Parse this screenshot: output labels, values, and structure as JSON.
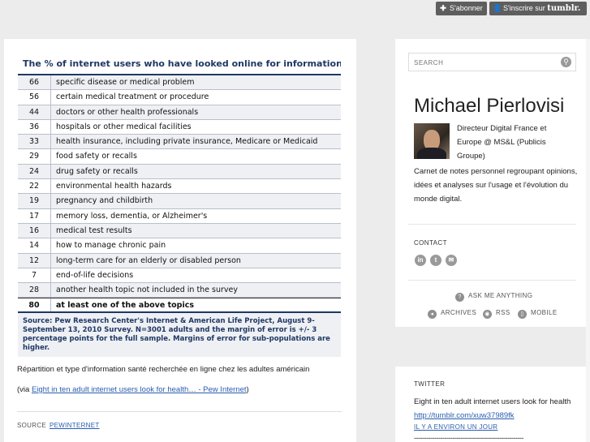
{
  "topbar": {
    "follow_label": "S'abonner",
    "signup_label": "S'inscrire sur",
    "signup_brand": "tumblr."
  },
  "post": {
    "table": {
      "title": "The % of internet users who have looked online for information about...",
      "rows": [
        {
          "value": "66",
          "label": "specific disease or medical problem"
        },
        {
          "value": "56",
          "label": "certain medical treatment or procedure"
        },
        {
          "value": "44",
          "label": "doctors or other health professionals"
        },
        {
          "value": "36",
          "label": "hospitals or other medical facilities"
        },
        {
          "value": "33",
          "label": "health insurance, including private insurance, Medicare or Medicaid"
        },
        {
          "value": "29",
          "label": "food safety or recalls"
        },
        {
          "value": "24",
          "label": "drug safety or recalls"
        },
        {
          "value": "22",
          "label": "environmental health hazards"
        },
        {
          "value": "19",
          "label": "pregnancy and childbirth"
        },
        {
          "value": "17",
          "label": "memory loss, dementia, or Alzheimer's"
        },
        {
          "value": "16",
          "label": "medical test results"
        },
        {
          "value": "14",
          "label": "how to manage chronic pain"
        },
        {
          "value": "12",
          "label": "long-term care for an elderly or disabled person"
        },
        {
          "value": "7",
          "label": "end-of-life decisions"
        },
        {
          "value": "28",
          "label": "another health topic not included in the survey"
        }
      ],
      "total": {
        "value": "80",
        "label": "at least one of the above topics"
      },
      "source": "Source: Pew Research Center's Internet & American Life Project, August 9-September 13, 2010 Survey. N=3001 adults and the margin of error is +/- 3 percentage points for the full sample. Margins of error for sub-populations are higher."
    },
    "caption": "Répartition et type d'information santé recherchée en ligne chez les adultes américain",
    "via_prefix": "(via ",
    "via_link": "Eight in ten adult internet users look for health… - Pew Internet",
    "via_suffix": ")",
    "source_label": "SOURCE",
    "source_link": "PEWINTERNET"
  },
  "sidebar": {
    "search_placeholder": "SEARCH",
    "blog_title": "Michael Pierlovisi",
    "description_short": "Directeur Digital France et Europe @ MS&L (Publicis Groupe)",
    "description_long": "Carnet de notes personnel regroupant opinions, idées et analyses sur l'usage et l'évolution du monde digital.",
    "contact_label": "CONTACT",
    "contact_icons": [
      "in",
      "t",
      "✉"
    ],
    "ask_label": "ASK ME ANYTHING",
    "archives_label": "ARCHIVES",
    "rss_label": "RSS",
    "mobile_label": "MOBILE",
    "twitter_label": "TWITTER",
    "tweet_text": "Eight in ten adult internet users look for health",
    "tweet_link": "http://tumblr.com/xuw37989fk",
    "tweet_time": "IL Y A ENVIRON UN JOUR",
    "dashes": "------------------------------------------------------"
  }
}
